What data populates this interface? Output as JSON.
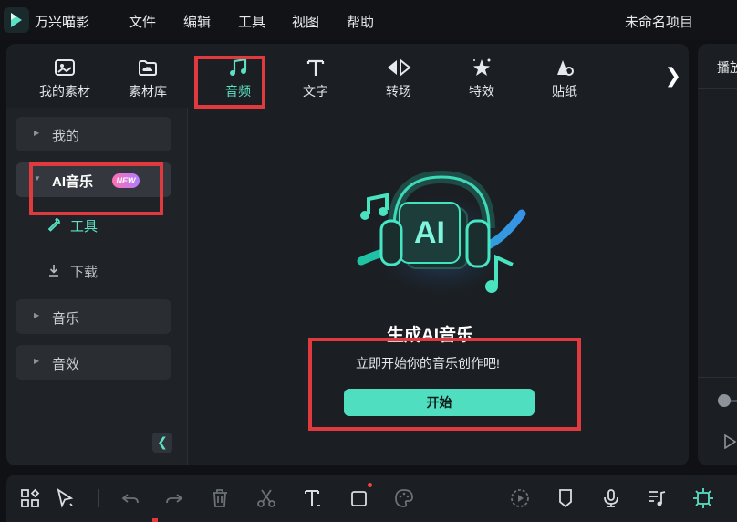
{
  "titlebar": {
    "app_name": "万兴喵影",
    "menu": [
      "文件",
      "编辑",
      "工具",
      "视图",
      "帮助"
    ],
    "project_name": "未命名项目"
  },
  "tabs": [
    {
      "label": "我的素材",
      "icon": "image-icon"
    },
    {
      "label": "素材库",
      "icon": "cloud-folder-icon"
    },
    {
      "label": "音频",
      "icon": "music-note-icon",
      "active": true
    },
    {
      "label": "文字",
      "icon": "text-icon"
    },
    {
      "label": "转场",
      "icon": "transition-icon"
    },
    {
      "label": "特效",
      "icon": "effects-icon"
    },
    {
      "label": "贴纸",
      "icon": "sticker-icon"
    }
  ],
  "sidebar": {
    "my": "我的",
    "ai_music": "AI音乐",
    "new_badge": "NEW",
    "tools": "工具",
    "download": "下载",
    "music": "音乐",
    "sound_effects": "音效"
  },
  "content": {
    "headline": "生成AI音乐",
    "subline": "立即开始你的音乐创作吧!",
    "start_button": "开始"
  },
  "preview": {
    "tab": "播放"
  },
  "colors": {
    "accent": "#4fdfc0",
    "annotation_red": "#e0393e",
    "panel_bg": "#1b1e22"
  }
}
